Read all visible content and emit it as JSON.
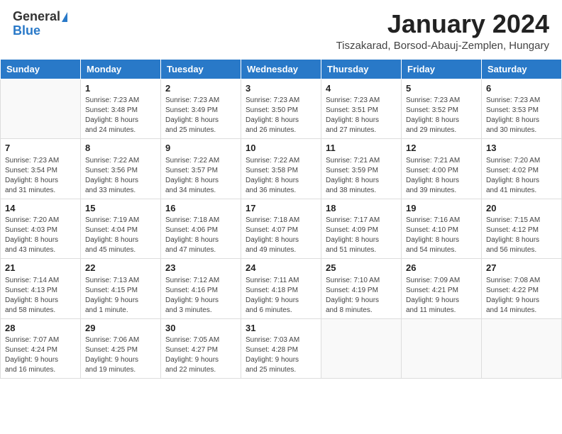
{
  "header": {
    "logo_general": "General",
    "logo_blue": "Blue",
    "title": "January 2024",
    "location": "Tiszakarad, Borsod-Abauj-Zemplen, Hungary"
  },
  "days_of_week": [
    "Sunday",
    "Monday",
    "Tuesday",
    "Wednesday",
    "Thursday",
    "Friday",
    "Saturday"
  ],
  "weeks": [
    [
      {
        "day": "",
        "info": ""
      },
      {
        "day": "1",
        "info": "Sunrise: 7:23 AM\nSunset: 3:48 PM\nDaylight: 8 hours\nand 24 minutes."
      },
      {
        "day": "2",
        "info": "Sunrise: 7:23 AM\nSunset: 3:49 PM\nDaylight: 8 hours\nand 25 minutes."
      },
      {
        "day": "3",
        "info": "Sunrise: 7:23 AM\nSunset: 3:50 PM\nDaylight: 8 hours\nand 26 minutes."
      },
      {
        "day": "4",
        "info": "Sunrise: 7:23 AM\nSunset: 3:51 PM\nDaylight: 8 hours\nand 27 minutes."
      },
      {
        "day": "5",
        "info": "Sunrise: 7:23 AM\nSunset: 3:52 PM\nDaylight: 8 hours\nand 29 minutes."
      },
      {
        "day": "6",
        "info": "Sunrise: 7:23 AM\nSunset: 3:53 PM\nDaylight: 8 hours\nand 30 minutes."
      }
    ],
    [
      {
        "day": "7",
        "info": "Sunrise: 7:23 AM\nSunset: 3:54 PM\nDaylight: 8 hours\nand 31 minutes."
      },
      {
        "day": "8",
        "info": "Sunrise: 7:22 AM\nSunset: 3:56 PM\nDaylight: 8 hours\nand 33 minutes."
      },
      {
        "day": "9",
        "info": "Sunrise: 7:22 AM\nSunset: 3:57 PM\nDaylight: 8 hours\nand 34 minutes."
      },
      {
        "day": "10",
        "info": "Sunrise: 7:22 AM\nSunset: 3:58 PM\nDaylight: 8 hours\nand 36 minutes."
      },
      {
        "day": "11",
        "info": "Sunrise: 7:21 AM\nSunset: 3:59 PM\nDaylight: 8 hours\nand 38 minutes."
      },
      {
        "day": "12",
        "info": "Sunrise: 7:21 AM\nSunset: 4:00 PM\nDaylight: 8 hours\nand 39 minutes."
      },
      {
        "day": "13",
        "info": "Sunrise: 7:20 AM\nSunset: 4:02 PM\nDaylight: 8 hours\nand 41 minutes."
      }
    ],
    [
      {
        "day": "14",
        "info": "Sunrise: 7:20 AM\nSunset: 4:03 PM\nDaylight: 8 hours\nand 43 minutes."
      },
      {
        "day": "15",
        "info": "Sunrise: 7:19 AM\nSunset: 4:04 PM\nDaylight: 8 hours\nand 45 minutes."
      },
      {
        "day": "16",
        "info": "Sunrise: 7:18 AM\nSunset: 4:06 PM\nDaylight: 8 hours\nand 47 minutes."
      },
      {
        "day": "17",
        "info": "Sunrise: 7:18 AM\nSunset: 4:07 PM\nDaylight: 8 hours\nand 49 minutes."
      },
      {
        "day": "18",
        "info": "Sunrise: 7:17 AM\nSunset: 4:09 PM\nDaylight: 8 hours\nand 51 minutes."
      },
      {
        "day": "19",
        "info": "Sunrise: 7:16 AM\nSunset: 4:10 PM\nDaylight: 8 hours\nand 54 minutes."
      },
      {
        "day": "20",
        "info": "Sunrise: 7:15 AM\nSunset: 4:12 PM\nDaylight: 8 hours\nand 56 minutes."
      }
    ],
    [
      {
        "day": "21",
        "info": "Sunrise: 7:14 AM\nSunset: 4:13 PM\nDaylight: 8 hours\nand 58 minutes."
      },
      {
        "day": "22",
        "info": "Sunrise: 7:13 AM\nSunset: 4:15 PM\nDaylight: 9 hours\nand 1 minute."
      },
      {
        "day": "23",
        "info": "Sunrise: 7:12 AM\nSunset: 4:16 PM\nDaylight: 9 hours\nand 3 minutes."
      },
      {
        "day": "24",
        "info": "Sunrise: 7:11 AM\nSunset: 4:18 PM\nDaylight: 9 hours\nand 6 minutes."
      },
      {
        "day": "25",
        "info": "Sunrise: 7:10 AM\nSunset: 4:19 PM\nDaylight: 9 hours\nand 8 minutes."
      },
      {
        "day": "26",
        "info": "Sunrise: 7:09 AM\nSunset: 4:21 PM\nDaylight: 9 hours\nand 11 minutes."
      },
      {
        "day": "27",
        "info": "Sunrise: 7:08 AM\nSunset: 4:22 PM\nDaylight: 9 hours\nand 14 minutes."
      }
    ],
    [
      {
        "day": "28",
        "info": "Sunrise: 7:07 AM\nSunset: 4:24 PM\nDaylight: 9 hours\nand 16 minutes."
      },
      {
        "day": "29",
        "info": "Sunrise: 7:06 AM\nSunset: 4:25 PM\nDaylight: 9 hours\nand 19 minutes."
      },
      {
        "day": "30",
        "info": "Sunrise: 7:05 AM\nSunset: 4:27 PM\nDaylight: 9 hours\nand 22 minutes."
      },
      {
        "day": "31",
        "info": "Sunrise: 7:03 AM\nSunset: 4:28 PM\nDaylight: 9 hours\nand 25 minutes."
      },
      {
        "day": "",
        "info": ""
      },
      {
        "day": "",
        "info": ""
      },
      {
        "day": "",
        "info": ""
      }
    ]
  ]
}
